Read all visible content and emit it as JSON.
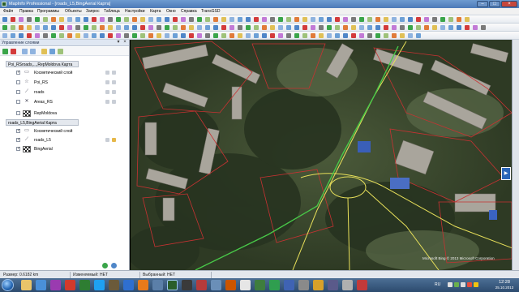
{
  "window": {
    "title": "MapInfo Professional - [roads_L5,BingAerial Карта]"
  },
  "menu": [
    "Файл",
    "Правка",
    "Программы",
    "Объекты",
    "Запрос",
    "Таблица",
    "Настройки",
    "Карта",
    "Окно",
    "Справка",
    "TransGSD"
  ],
  "layer_panel": {
    "title": "Управление слоями",
    "maps": [
      {
        "label": "Poi_RSroads,...,RepMoldova Карта",
        "layers": [
          {
            "name": "Косметический слой",
            "checked": true,
            "icon": "cosmetic-layer-icon"
          },
          {
            "name": "Poi_RS",
            "checked": false,
            "icon": "star-icon"
          },
          {
            "name": "roads",
            "checked": false,
            "icon": "polyline-icon"
          },
          {
            "name": "Areas_RS",
            "checked": false,
            "icon": "cross-region-icon"
          },
          {
            "name": "RepMoldova",
            "checked": false,
            "icon": "checker-raster-icon"
          }
        ]
      },
      {
        "label": "roads_L5,BingAerial Карта",
        "layers": [
          {
            "name": "Косметический слой",
            "checked": true,
            "icon": "cosmetic-layer-icon"
          },
          {
            "name": "roads_L5",
            "checked": true,
            "icon": "polyline-icon"
          },
          {
            "name": "BingAerial",
            "checked": true,
            "icon": "checker-raster-icon"
          }
        ]
      }
    ]
  },
  "map": {
    "attribution": "Microsoft Bing © 2013 Microsoft Corporation"
  },
  "status": {
    "zoom": "Размер: 0.6182 km",
    "editable": "Изменяемый: НЕТ",
    "selectable": "Выбранный: НЕТ"
  },
  "taskbar": {
    "lang": "RU",
    "time": "12:28",
    "date": "25.10.2013"
  },
  "colors": {
    "title_bar": "#4c7ab8",
    "panel_bg": "#ffffff",
    "road_yellow": "#e8e05a",
    "road_green": "#48c848",
    "boundary_red": "#c83232"
  }
}
